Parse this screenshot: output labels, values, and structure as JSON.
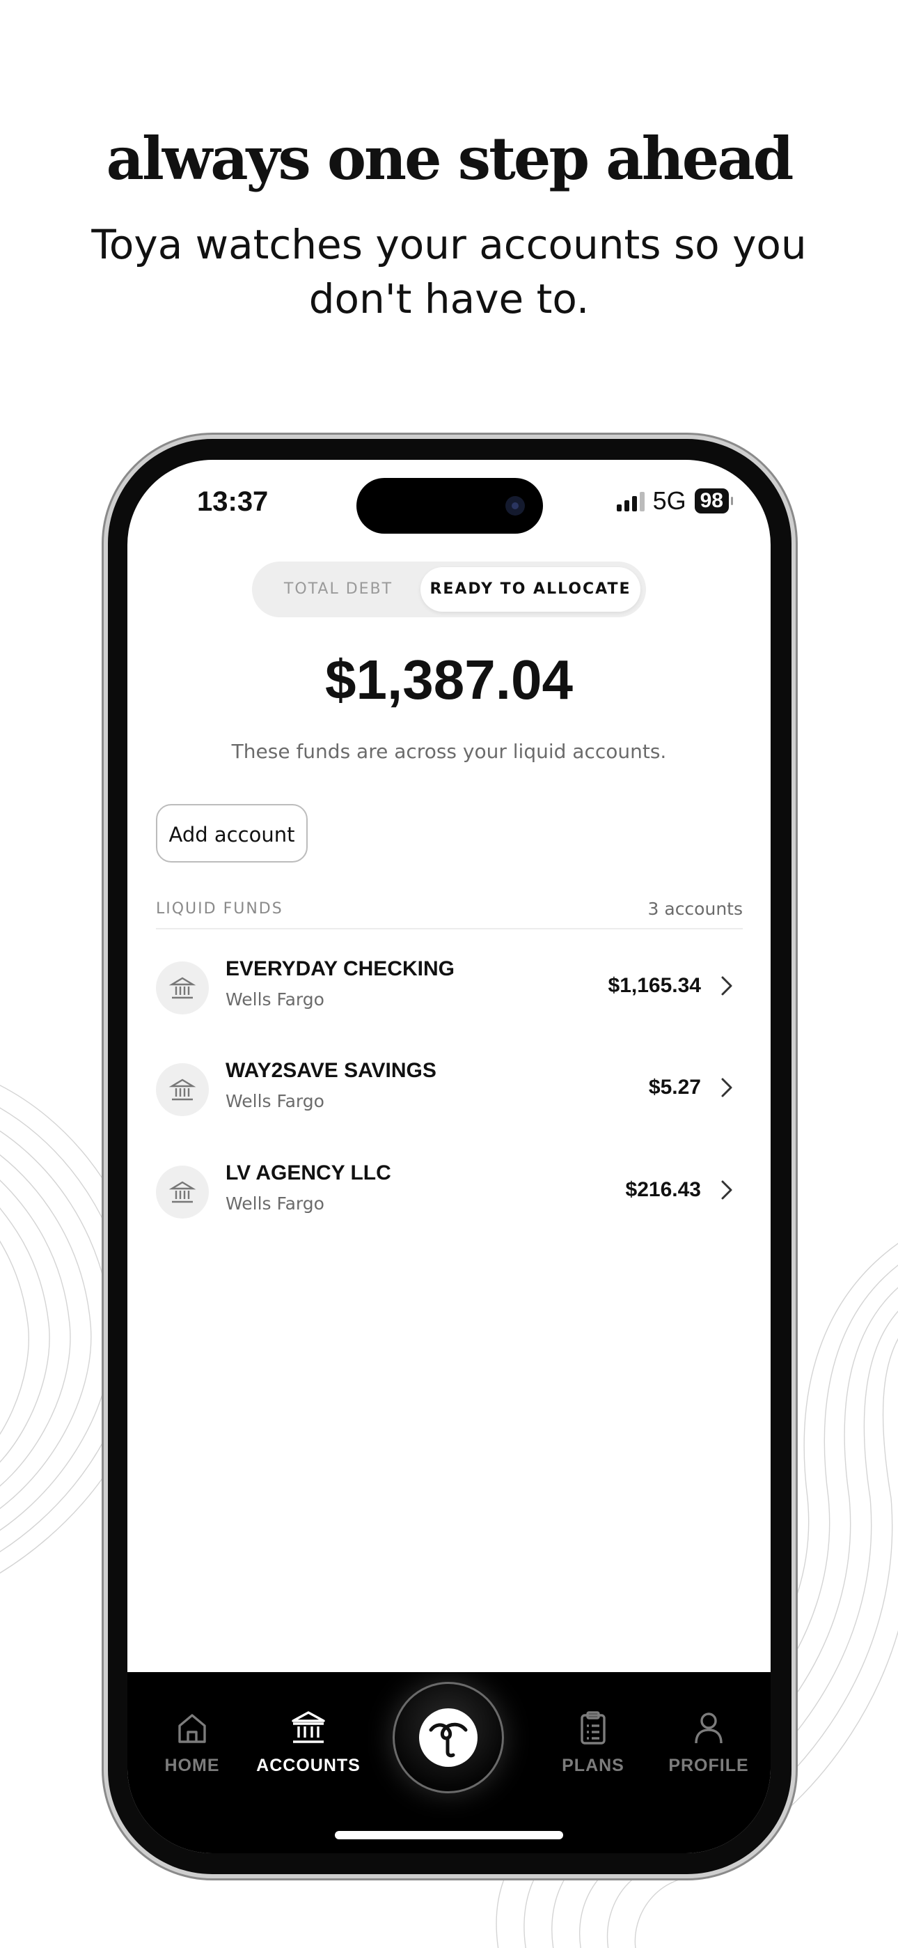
{
  "headline": "always one step ahead",
  "subheadline": "Toya watches your accounts so you don't have to.",
  "status_bar": {
    "time": "13:37",
    "network": "5G",
    "battery": "98"
  },
  "toggle": {
    "options": [
      "TOTAL DEBT",
      "READY TO ALLOCATE"
    ],
    "selected": "READY TO ALLOCATE"
  },
  "balance": {
    "amount": "$1,387.04",
    "description": "These funds are across your liquid accounts."
  },
  "add_account_label": "Add account",
  "section": {
    "title": "LIQUID FUNDS",
    "count": "3 accounts"
  },
  "accounts": [
    {
      "name": "EVERYDAY CHECKING",
      "bank": "Wells Fargo",
      "amount": "$1,165.34"
    },
    {
      "name": "WAY2SAVE SAVINGS",
      "bank": "Wells Fargo",
      "amount": "$5.27"
    },
    {
      "name": "LV AGENCY LLC",
      "bank": "Wells Fargo",
      "amount": "$216.43"
    }
  ],
  "tabs": [
    {
      "label": "HOME",
      "icon": "home-icon",
      "active": false
    },
    {
      "label": "ACCOUNTS",
      "icon": "bank-icon",
      "active": true
    },
    {
      "label": "",
      "icon": "toya-logo-icon",
      "active": false
    },
    {
      "label": "PLANS",
      "icon": "clipboard-icon",
      "active": false
    },
    {
      "label": "PROFILE",
      "icon": "person-icon",
      "active": false
    }
  ],
  "colors": {
    "background": "#ffffff",
    "text": "#111111",
    "tabbar": "#000000",
    "muted": "#6b6b6b"
  }
}
